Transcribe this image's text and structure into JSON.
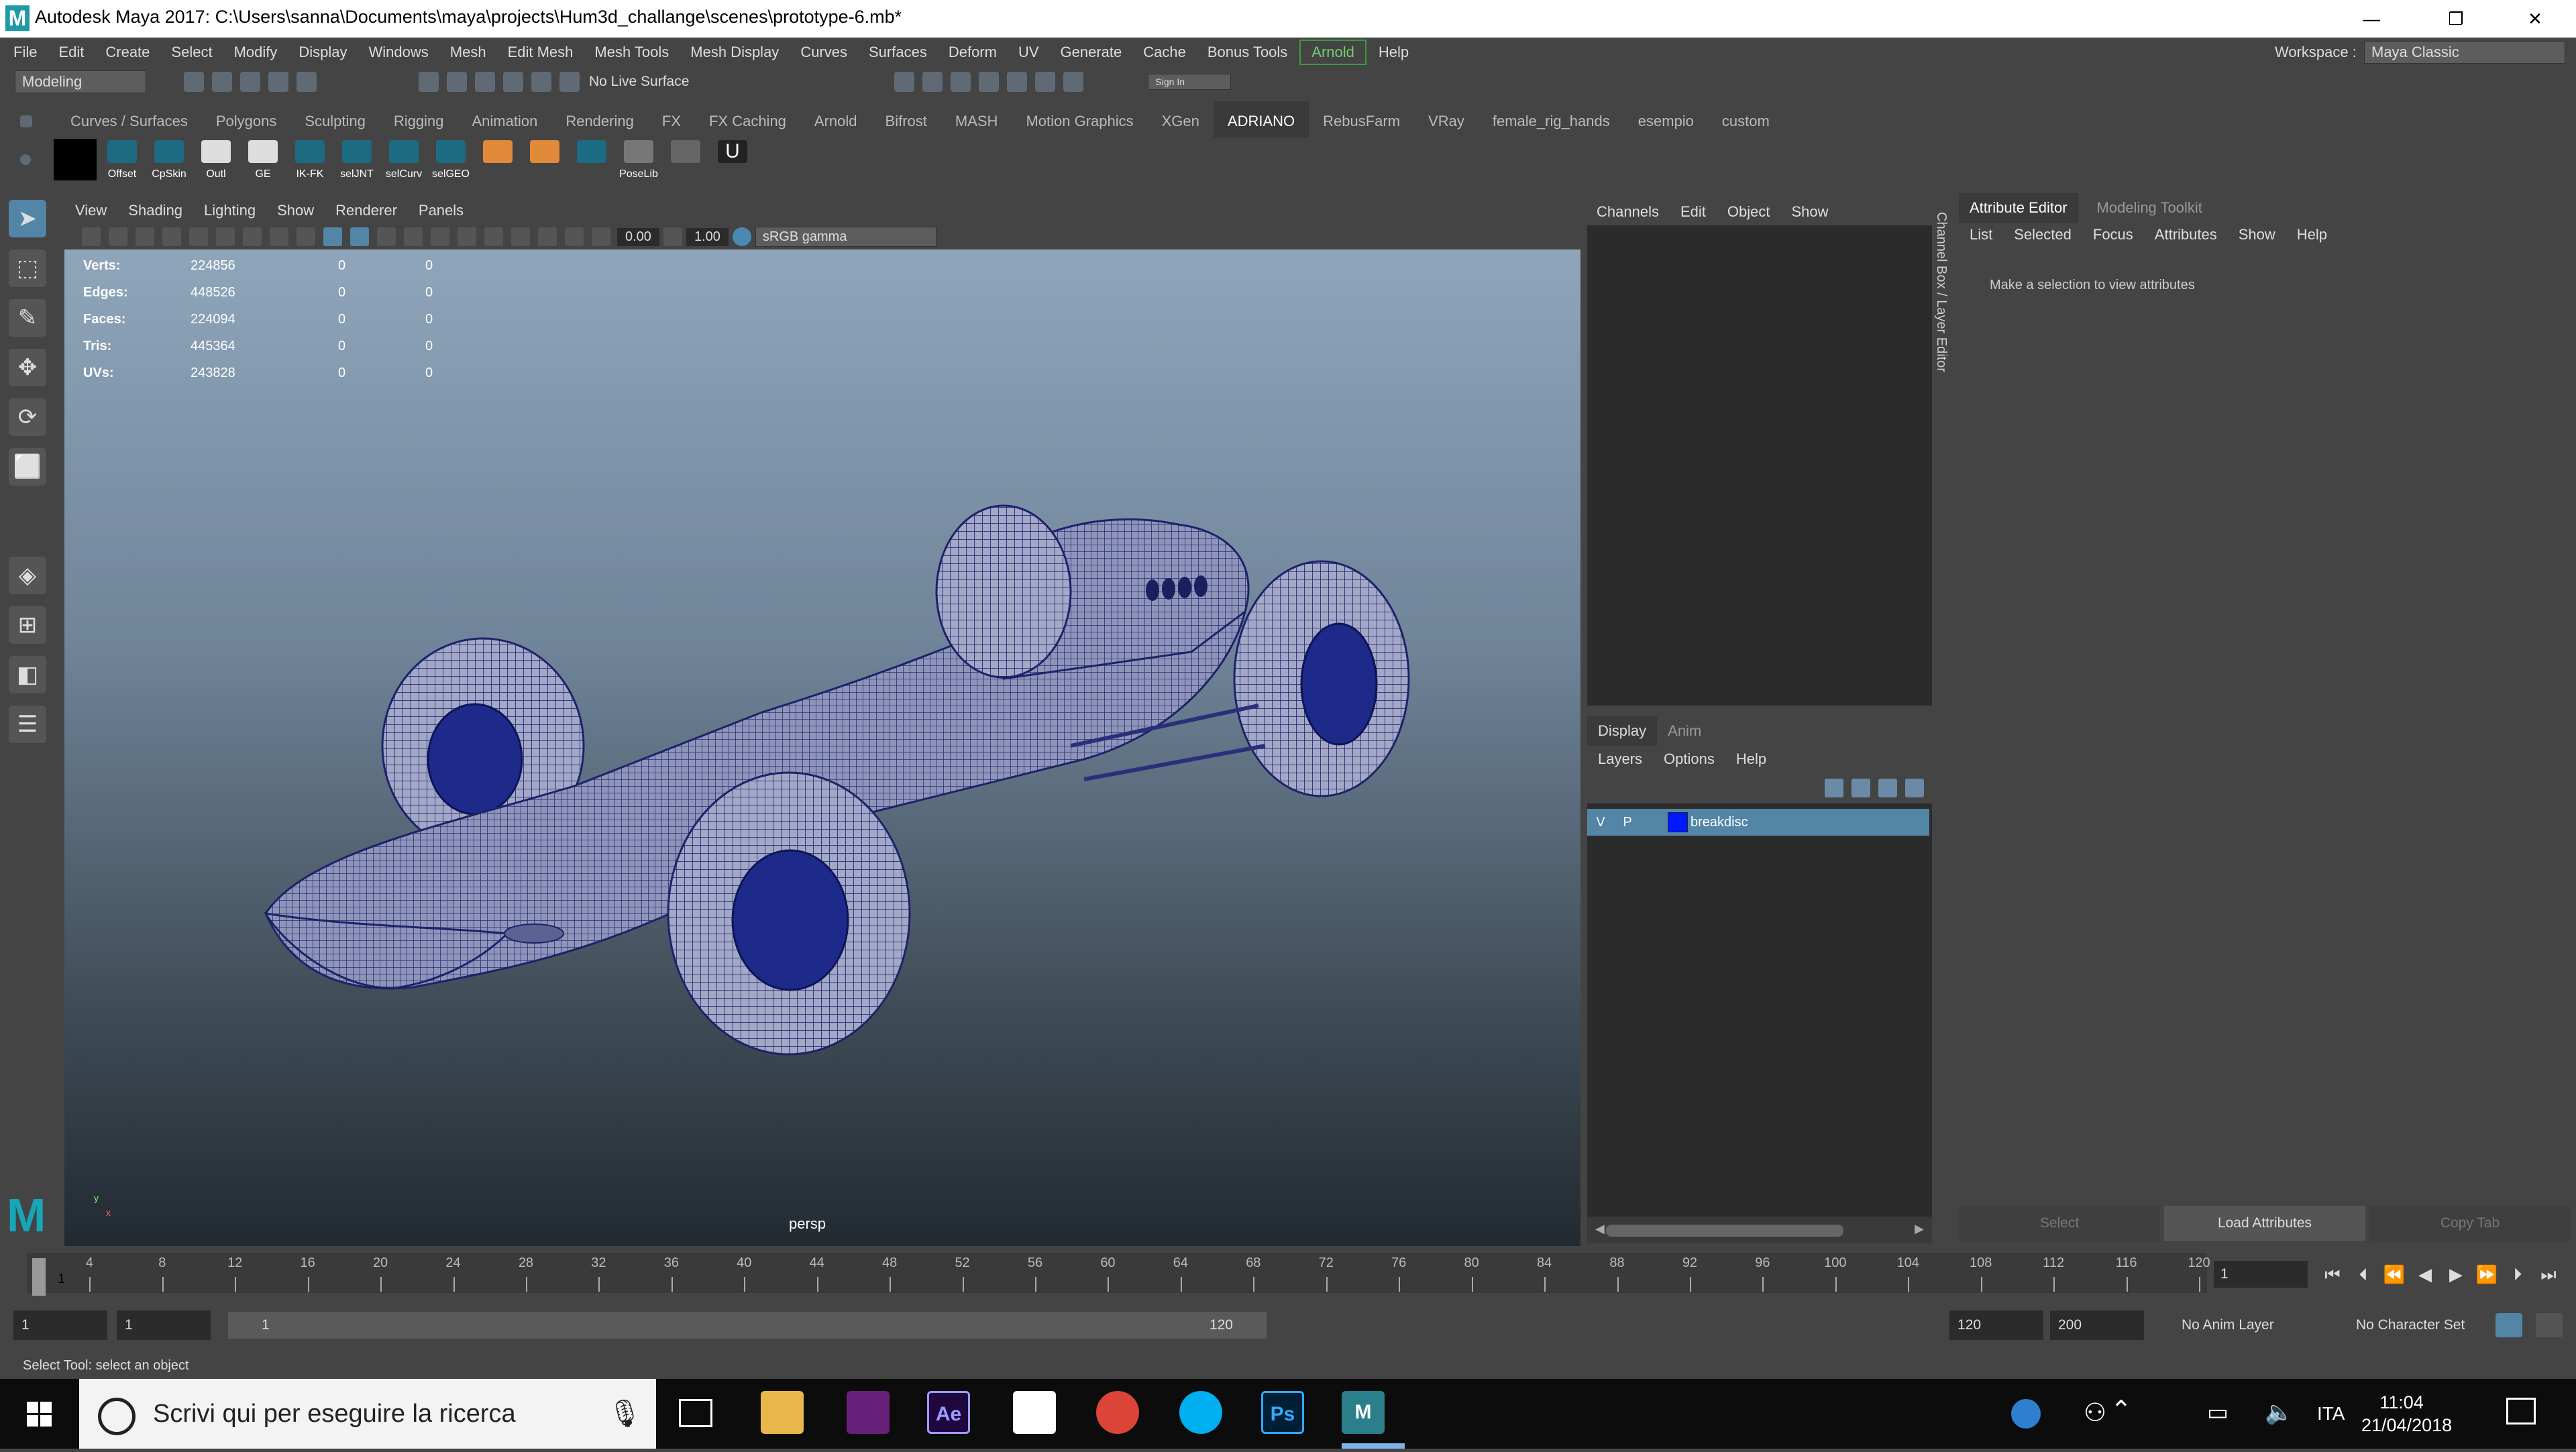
{
  "window": {
    "title": "Autodesk Maya 2017: C:\\Users\\sanna\\Documents\\maya\\projects\\Hum3d_challange\\scenes\\prototype-6.mb*",
    "logo": "M",
    "minimize": "—",
    "restore": "❐",
    "close": "✕"
  },
  "menubar": {
    "items": [
      "File",
      "Edit",
      "Create",
      "Select",
      "Modify",
      "Display",
      "Windows",
      "Mesh",
      "Edit Mesh",
      "Mesh Tools",
      "Mesh Display",
      "Curves",
      "Surfaces",
      "Deform",
      "UV",
      "Generate",
      "Cache",
      "Bonus Tools",
      "Arnold",
      "Help"
    ],
    "workspace_label": "Workspace :",
    "workspace_value": "Maya Classic"
  },
  "statusline": {
    "menuset": "Modeling",
    "live_surface": "No Live Surface",
    "sign_in": "Sign In"
  },
  "shelf": {
    "tabs": [
      "Curves / Surfaces",
      "Polygons",
      "Sculpting",
      "Rigging",
      "Animation",
      "Rendering",
      "FX",
      "FX Caching",
      "Arnold",
      "Bifrost",
      "MASH",
      "Motion Graphics",
      "XGen",
      "ADRIANO",
      "RebusFarm",
      "VRay",
      "female_rig_hands",
      "esempio",
      "custom"
    ],
    "active_tab": "ADRIANO",
    "buttons": [
      "Offset",
      "CpSkin",
      "Outl",
      "GE",
      "IK-FK",
      "selJNT",
      "selCurv",
      "selGEO"
    ],
    "poselib": "PoseLib"
  },
  "viewport": {
    "menu": [
      "View",
      "Shading",
      "Lighting",
      "Show",
      "Renderer",
      "Panels"
    ],
    "exposure": "0.00",
    "gamma": "1.00",
    "colorspace": "sRGB gamma",
    "camera": "persp",
    "hud": [
      {
        "label": "Verts:",
        "value": "224856",
        "sel": "0",
        "comp": "0"
      },
      {
        "label": "Edges:",
        "value": "448526",
        "sel": "0",
        "comp": "0"
      },
      {
        "label": "Faces:",
        "value": "224094",
        "sel": "0",
        "comp": "0"
      },
      {
        "label": "Tris:",
        "value": "445364",
        "sel": "0",
        "comp": "0"
      },
      {
        "label": "UVs:",
        "value": "243828",
        "sel": "0",
        "comp": "0"
      }
    ],
    "axis_y": "y",
    "axis_x": "x"
  },
  "channelbox": {
    "menu": [
      "Channels",
      "Edit",
      "Object",
      "Show"
    ],
    "side_tab": "Channel Box / Layer Editor"
  },
  "layereditor": {
    "tabs": [
      "Display",
      "Anim"
    ],
    "menu": [
      "Layers",
      "Options",
      "Help"
    ],
    "layer": {
      "v": "V",
      "p": "P",
      "name": "breakdisc",
      "color": "#0019ff"
    }
  },
  "attribute_editor": {
    "tabs": [
      "Attribute Editor",
      "Modeling Toolkit"
    ],
    "menu": [
      "List",
      "Selected",
      "Focus",
      "Attributes",
      "Show",
      "Help"
    ],
    "message": "Make a selection to view attributes",
    "buttons": [
      "Select",
      "Load Attributes",
      "Copy Tab"
    ]
  },
  "timeslider": {
    "ticks": [
      "4",
      "8",
      "12",
      "16",
      "20",
      "24",
      "28",
      "32",
      "36",
      "40",
      "44",
      "48",
      "52",
      "56",
      "60",
      "64",
      "68",
      "72",
      "76",
      "80",
      "84",
      "88",
      "92",
      "96",
      "100",
      "104",
      "108",
      "112",
      "116",
      "120"
    ],
    "current": "1",
    "current_field": "1"
  },
  "rangeslider": {
    "anim_start": "1",
    "playback_start": "1",
    "range_start": "1",
    "range_end": "120",
    "playback_end": "120",
    "anim_end": "200",
    "anim_layer": "No Anim Layer",
    "character_set": "No Character Set"
  },
  "helpline": {
    "text": "Select Tool: select an object"
  },
  "taskbar": {
    "search_placeholder": "Scrivi qui per eseguire la ricerca",
    "language": "ITA",
    "time": "11:04",
    "date": "21/04/2018",
    "apps": [
      "Ae",
      "Ps",
      "M"
    ]
  }
}
